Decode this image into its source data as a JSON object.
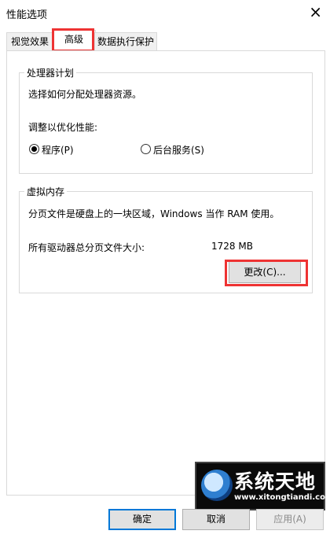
{
  "window": {
    "title": "性能选项",
    "close_glyph": "×"
  },
  "tabs": [
    {
      "label": "视觉效果"
    },
    {
      "label": "高级"
    },
    {
      "label": "数据执行保护"
    }
  ],
  "processor_scheduling": {
    "group_label": "处理器计划",
    "description": "选择如何分配处理器资源。",
    "adjust_label": "调整以优化性能:",
    "options": [
      {
        "label": "程序(P)",
        "selected": true
      },
      {
        "label": "后台服务(S)",
        "selected": false
      }
    ]
  },
  "virtual_memory": {
    "group_label": "虚拟内存",
    "description": "分页文件是硬盘上的一块区域，Windows 当作 RAM 使用。",
    "total_label": "所有驱动器总分页文件大小:",
    "total_value": "1728 MB",
    "change_button": "更改(C)..."
  },
  "footer": {
    "ok": "确定",
    "cancel": "取消",
    "apply": "应用(A)"
  },
  "watermark": {
    "text_cn": "系统天地",
    "url": "www.xitongtiandi.com"
  },
  "colors": {
    "highlight_red": "#ee3333",
    "primary_border": "#0078d7"
  }
}
